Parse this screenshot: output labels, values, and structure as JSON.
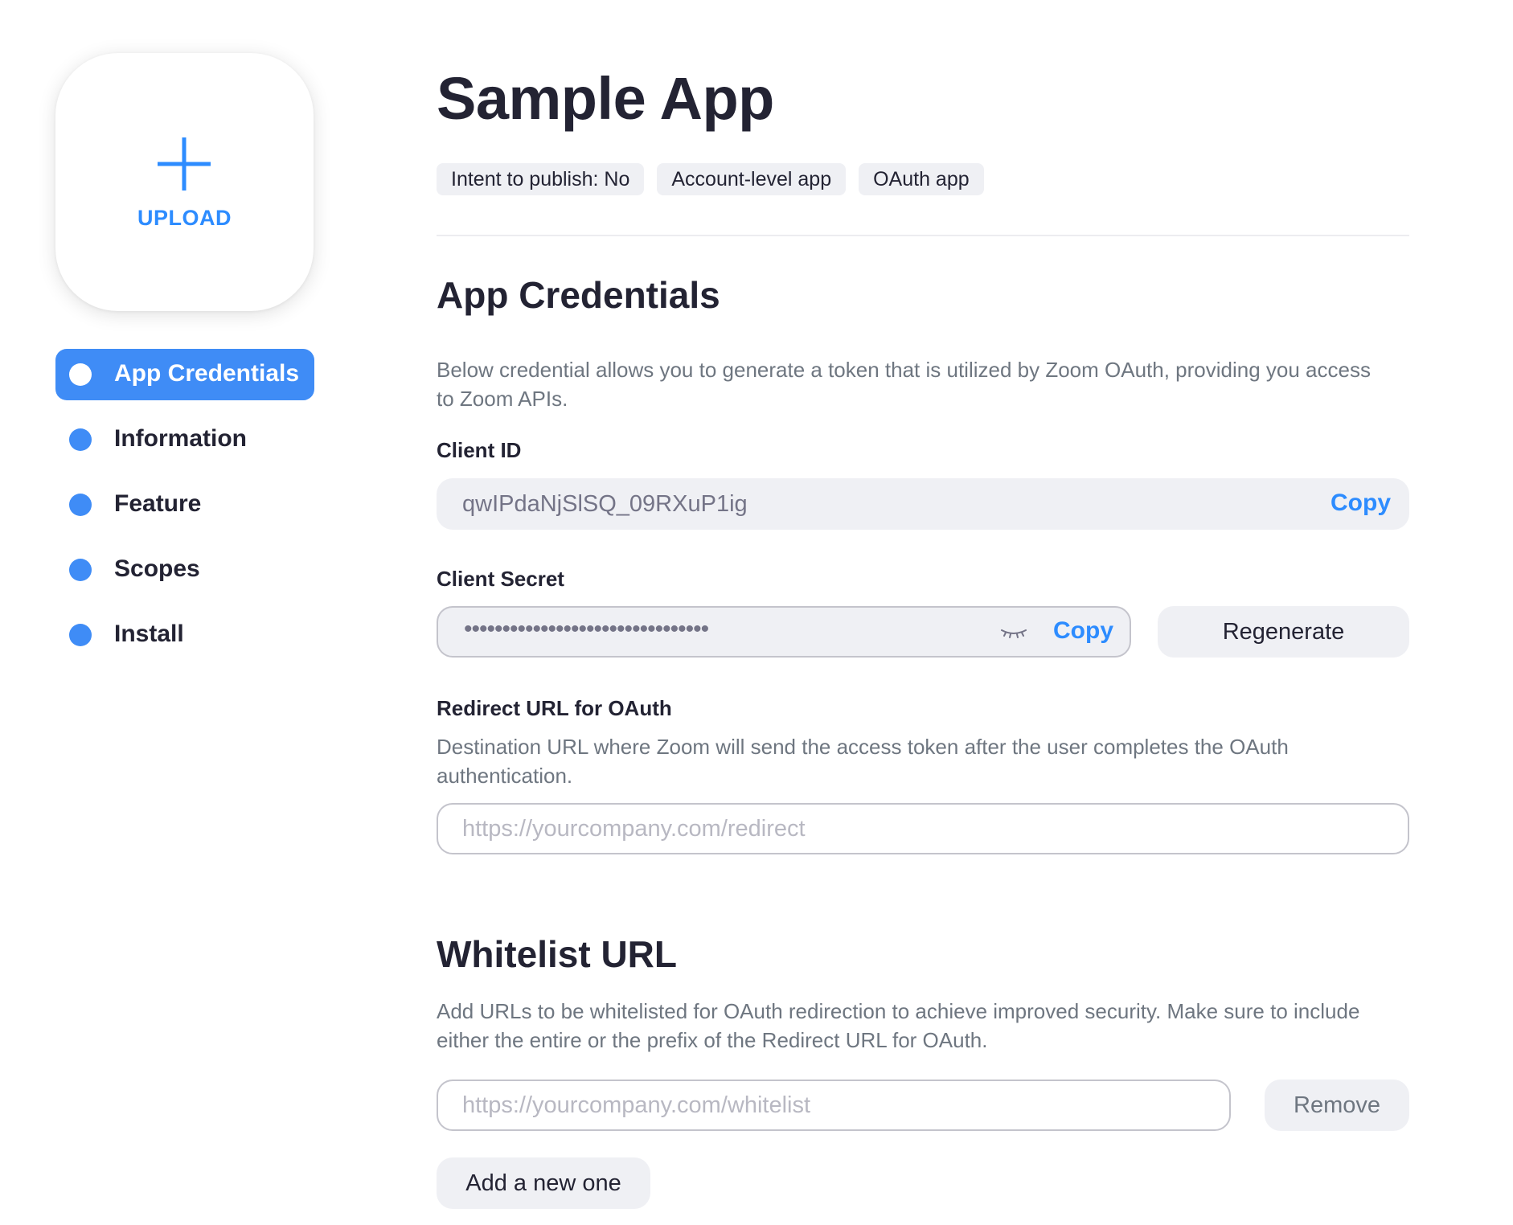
{
  "sidebar": {
    "upload_label": "UPLOAD",
    "items": [
      {
        "label": "App Credentials",
        "active": true
      },
      {
        "label": "Information",
        "active": false
      },
      {
        "label": "Feature",
        "active": false
      },
      {
        "label": "Scopes",
        "active": false
      },
      {
        "label": "Install",
        "active": false
      }
    ]
  },
  "header": {
    "title": "Sample App",
    "tags": [
      "Intent to publish: No",
      "Account-level app",
      "OAuth app"
    ]
  },
  "credentials": {
    "section_title": "App Credentials",
    "description": "Below credential allows you to generate a token that is utilized by Zoom OAuth, providing you access to Zoom APIs.",
    "client_id_label": "Client ID",
    "client_id_value": "qwIPdaNjSlSQ_09RXuP1ig",
    "copy_label": "Copy",
    "client_secret_label": "Client Secret",
    "client_secret_masked": "••••••••••••••••••••••••••••••••",
    "regenerate_label": "Regenerate",
    "redirect_label": "Redirect URL for OAuth",
    "redirect_description": "Destination URL where Zoom will send the access token after the user completes the OAuth authentication.",
    "redirect_placeholder": "https://yourcompany.com/redirect"
  },
  "whitelist": {
    "section_title": "Whitelist URL",
    "description": "Add URLs to be whitelisted for OAuth redirection to achieve improved security. Make sure to include either the entire or the prefix of the Redirect URL for OAuth.",
    "placeholder": "https://yourcompany.com/whitelist",
    "remove_label": "Remove",
    "add_label": "Add a new one"
  },
  "colors": {
    "accent": "#2d8cff",
    "nav_active_bg": "#3f8cf6",
    "field_bg": "#eff0f4",
    "text_primary": "#232333",
    "text_secondary": "#6e7680"
  },
  "icons": {
    "upload": "plus-icon",
    "secret_visibility": "eye-closed-icon",
    "nav_bullet": "dot-icon"
  }
}
